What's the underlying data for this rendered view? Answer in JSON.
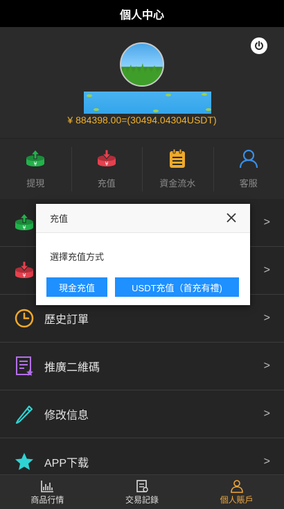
{
  "header": {
    "title": "個人中心"
  },
  "profile": {
    "balance": "¥ 884398.00=(30494.04304USDT)"
  },
  "quick_actions": [
    {
      "label": "提現",
      "icon": "withdraw-icon",
      "color": "#22b24c"
    },
    {
      "label": "充值",
      "icon": "deposit-icon",
      "color": "#e5414e"
    },
    {
      "label": "資金流水",
      "icon": "ledger-icon",
      "color": "#f0a92a"
    },
    {
      "label": "客服",
      "icon": "user-service-icon",
      "color": "#3a8ee6"
    }
  ],
  "menu": [
    {
      "label": "",
      "icon": "withdraw-icon"
    },
    {
      "label": "",
      "icon": "deposit-icon"
    },
    {
      "label": "歷史訂單",
      "icon": "clock-icon",
      "color": "#f0a92a"
    },
    {
      "label": "推廣二維碼",
      "icon": "document-star-icon",
      "color": "#b46ee8"
    },
    {
      "label": "修改信息",
      "icon": "pencil-icon",
      "color": "#2fd3d3"
    },
    {
      "label": "APP下载",
      "icon": "star-icon",
      "color": "#2fd3d3"
    }
  ],
  "chevron": ">",
  "dialog": {
    "title": "充值",
    "message": "選擇充值方式",
    "buttons": {
      "cash": "現金充值",
      "usdt": "USDT充值（首充有禮)"
    }
  },
  "bottom_nav": [
    {
      "label": "商品行情",
      "icon": "chart-icon",
      "active": false
    },
    {
      "label": "交易記錄",
      "icon": "record-icon",
      "active": false
    },
    {
      "label": "個人賬戶",
      "icon": "person-icon",
      "active": true
    }
  ],
  "colors": {
    "accent": "#f1b12a",
    "primary_button": "#1e90ff",
    "active_nav": "#f1a73a"
  }
}
